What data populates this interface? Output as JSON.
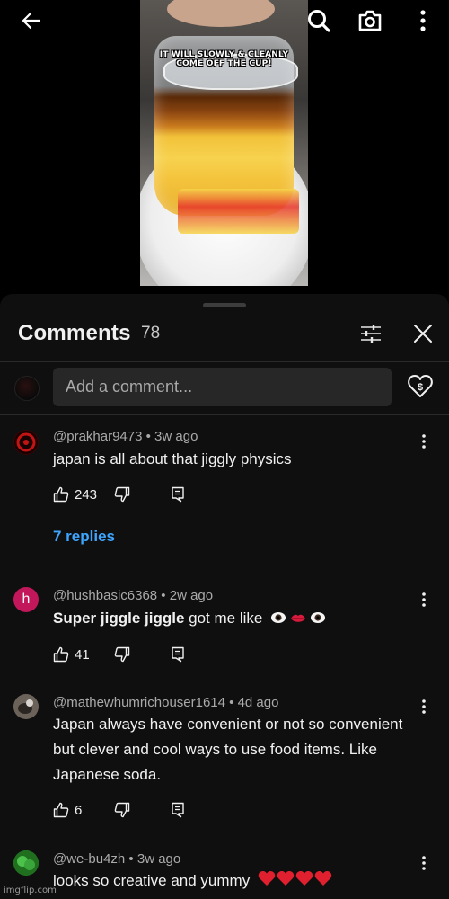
{
  "video": {
    "caption_line1": "IT WILL SLOWLY & CLEANLY",
    "caption_line2": "COME OFF THE CUP!"
  },
  "top_bar": {
    "back_icon": "arrow-left-icon",
    "search_icon": "search-icon",
    "camera_icon": "camera-icon",
    "more_icon": "more-vert-icon"
  },
  "comments_sheet": {
    "title": "Comments",
    "count": "78",
    "filter_icon": "sliders-icon",
    "close_icon": "close-icon",
    "add_comment_placeholder": "Add a comment...",
    "thanks_icon": "super-thanks-icon"
  },
  "comments": [
    {
      "author": "@prakhar9473",
      "age": "3w ago",
      "meta": "@prakhar9473 • 3w ago",
      "text": "japan is all about that jiggly physics",
      "likes": "243",
      "replies": "7 replies",
      "avatar_color": "#7a0c0c"
    },
    {
      "author": "@hushbasic6368",
      "age": "2w ago",
      "meta": "@hushbasic6368 • 2w ago",
      "text_bold": "Super jiggle jiggle",
      "text_rest": " got me like",
      "likes": "41",
      "avatar_letter": "h",
      "avatar_color": "#c2185b"
    },
    {
      "author": "@mathewhumrichouser1614",
      "age": "4d ago",
      "meta": "@mathewhumrichouser1614 • 4d ago",
      "text": "Japan always have convenient or not so convenient but clever and cool ways to use food items. Like Japanese soda.",
      "likes": "6",
      "avatar_color": "#5c5248"
    },
    {
      "author": "@we-bu4zh",
      "age": "3w ago",
      "meta": "@we-bu4zh • 3w ago",
      "text": "looks so creative and yummy",
      "avatar_color": "#2e9a2e"
    }
  ],
  "watermark": "imgflip.com"
}
